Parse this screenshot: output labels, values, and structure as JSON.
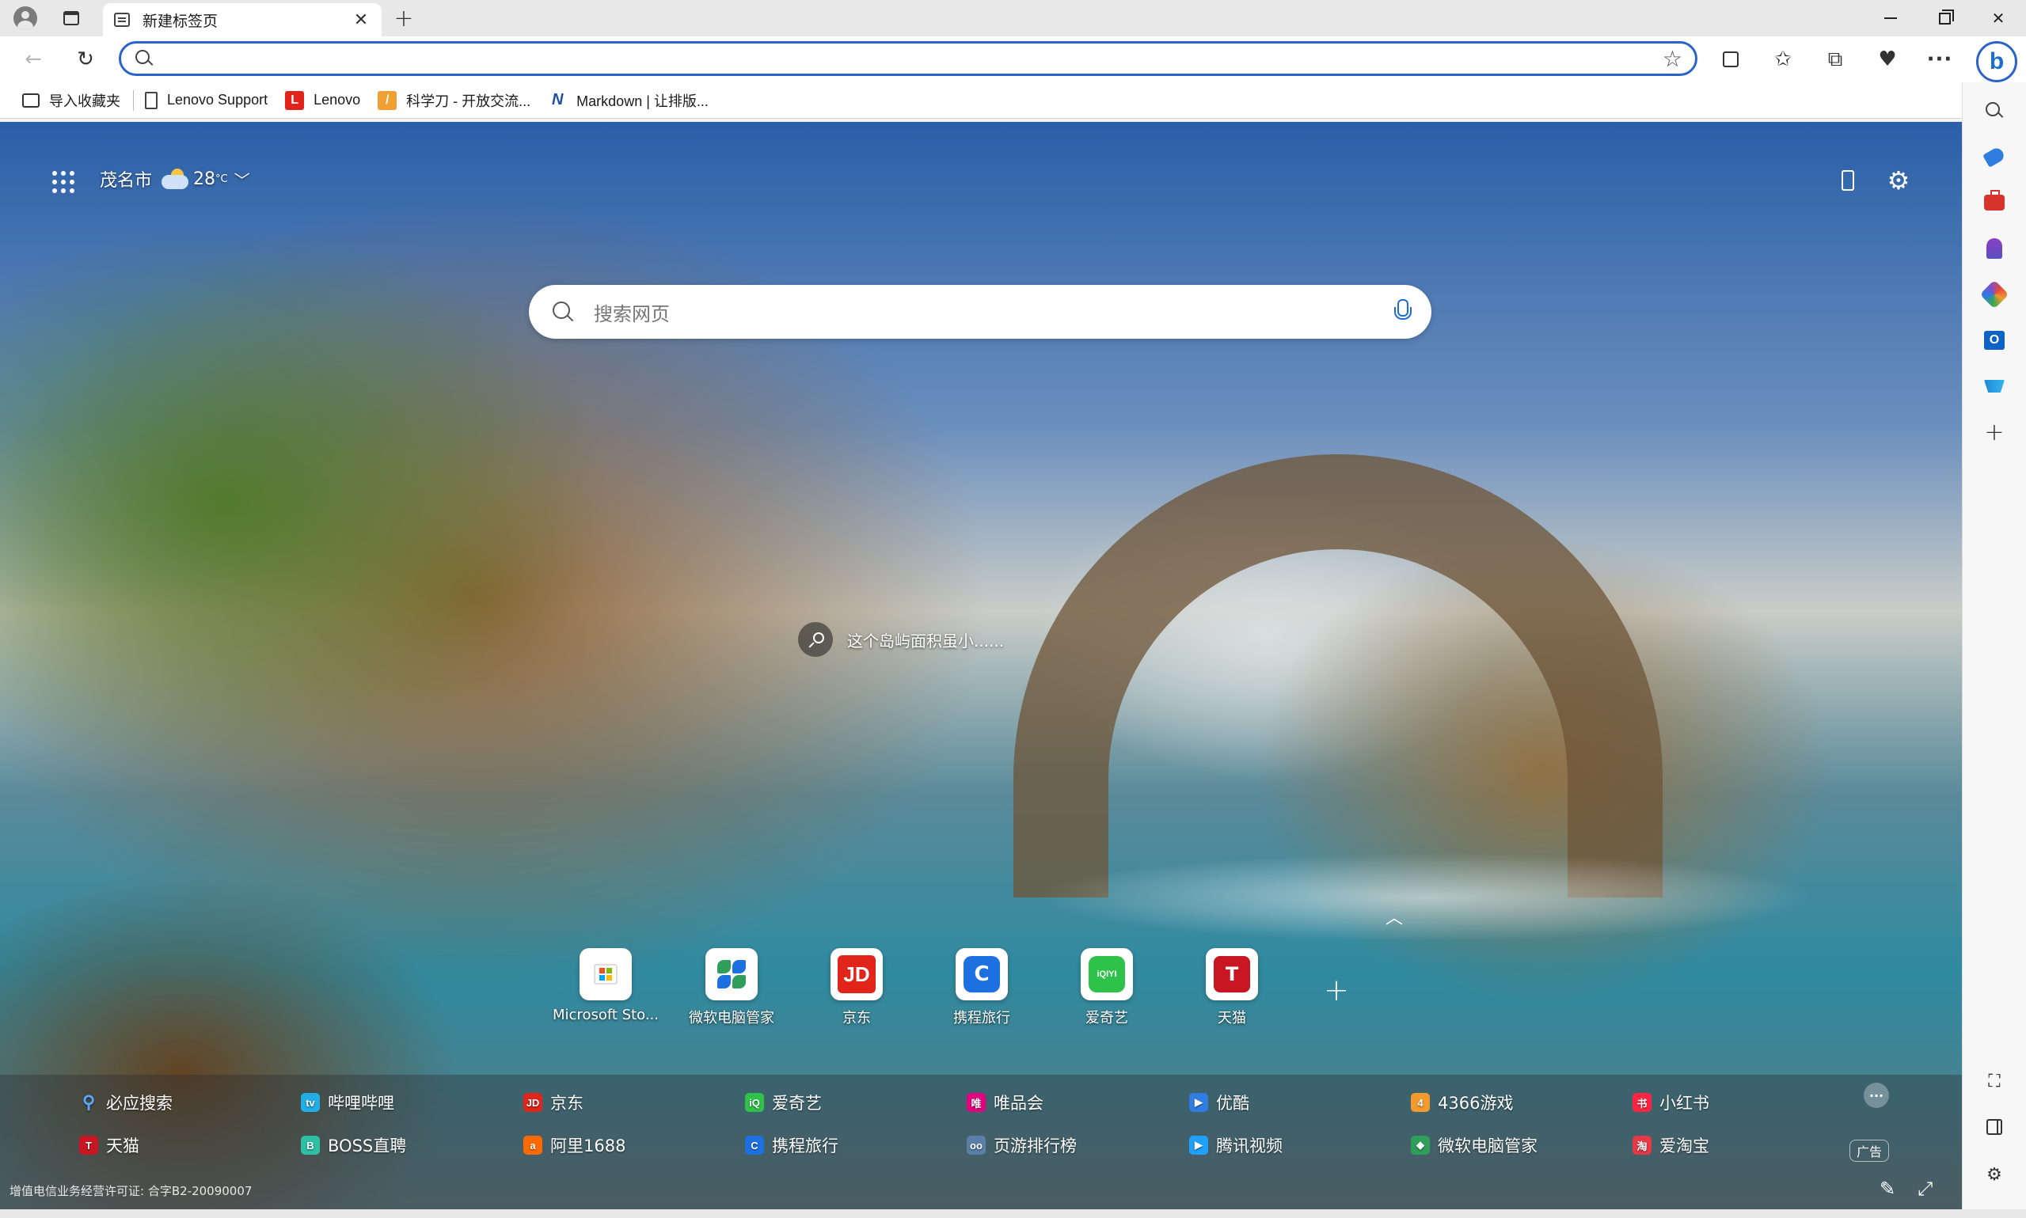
{
  "tab": {
    "title": "新建标签页"
  },
  "address_bar": {
    "value": ""
  },
  "favorites_bar": [
    {
      "label": "导入收藏夹",
      "icon": "import-folder-icon"
    },
    {
      "label": "Lenovo Support",
      "icon": "page-icon"
    },
    {
      "label": "Lenovo",
      "icon": "lenovo-icon"
    },
    {
      "label": "科学刀 - 开放交流...",
      "icon": "kexuedao-icon"
    },
    {
      "label": "Markdown | 让排版...",
      "icon": "markdown-icon"
    }
  ],
  "weather": {
    "city": "茂名市",
    "temp": "28",
    "unit": "°C"
  },
  "search": {
    "placeholder": "搜索网页"
  },
  "image_caption": "这个岛屿面积虽小......",
  "quick_links": [
    {
      "label": "Microsoft Sto...",
      "icon": "microsoft-store-icon"
    },
    {
      "label": "微软电脑管家",
      "icon": "pc-manager-icon"
    },
    {
      "label": "京东",
      "icon": "jd-icon",
      "glyph": "JD"
    },
    {
      "label": "携程旅行",
      "icon": "ctrip-icon",
      "glyph": "C"
    },
    {
      "label": "爱奇艺",
      "icon": "iqiyi-icon",
      "glyph": "iQIYI"
    },
    {
      "label": "天猫",
      "icon": "tmall-icon",
      "glyph": "T"
    }
  ],
  "link_panel": {
    "row1": [
      {
        "label": "必应搜索",
        "icon": "bing-search-icon",
        "color": "#1c6dd0",
        "glyph": "Q"
      },
      {
        "label": "哔哩哔哩",
        "icon": "bilibili-icon",
        "color": "#23ade5",
        "glyph": "tv"
      },
      {
        "label": "京东",
        "icon": "jd-icon",
        "color": "#e1251b",
        "glyph": "JD"
      },
      {
        "label": "爱奇艺",
        "icon": "iqiyi-icon",
        "color": "#2fc24a",
        "glyph": "iQ"
      },
      {
        "label": "唯品会",
        "icon": "vip-icon",
        "color": "#e4007f",
        "glyph": "唯"
      },
      {
        "label": "优酷",
        "icon": "youku-icon",
        "color": "#2f7de1",
        "glyph": "▶"
      },
      {
        "label": "4366游戏",
        "icon": "4366-icon",
        "color": "#f29a2e",
        "glyph": "4"
      },
      {
        "label": "小红书",
        "icon": "xiaohongshu-icon",
        "color": "#ff2442",
        "glyph": "书"
      }
    ],
    "row2": [
      {
        "label": "天猫",
        "icon": "tmall-icon",
        "color": "#c81623",
        "glyph": "T"
      },
      {
        "label": "BOSS直聘",
        "icon": "boss-icon",
        "color": "#2fbfa4",
        "glyph": "B"
      },
      {
        "label": "阿里1688",
        "icon": "ali1688-icon",
        "color": "#ff6a00",
        "glyph": "a"
      },
      {
        "label": "携程旅行",
        "icon": "ctrip-icon",
        "color": "#1c70e0",
        "glyph": "C"
      },
      {
        "label": "页游排行榜",
        "icon": "webgame-icon",
        "color": "#5a7fa8",
        "glyph": "oo"
      },
      {
        "label": "腾讯视频",
        "icon": "tencent-video-icon",
        "color": "#20a0ff",
        "glyph": "▶"
      },
      {
        "label": "微软电脑管家",
        "icon": "pc-manager-icon",
        "color": "#2f9e5a",
        "glyph": "◆"
      },
      {
        "label": "爱淘宝",
        "icon": "aitaobao-icon",
        "color": "#e63946",
        "glyph": "淘"
      }
    ],
    "more": "···",
    "ad": "广告"
  },
  "license": "增值电信业务经营许可证: 合字B2-20090007",
  "colors": {
    "accent": "#2a63c9",
    "tab_strip": "#e8e8e8"
  }
}
